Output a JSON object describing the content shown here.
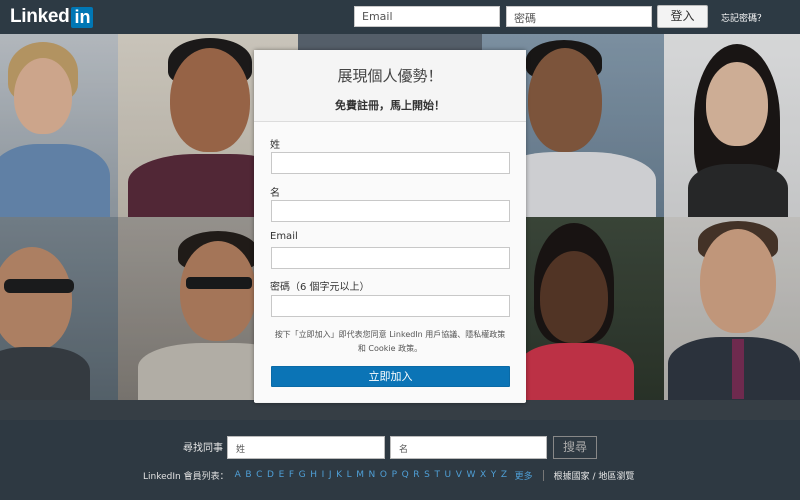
{
  "brand": {
    "logo_text": "Linked",
    "logo_box": "in"
  },
  "header": {
    "email_placeholder": "Email",
    "password_placeholder": "密碼",
    "login_label": "登入",
    "forgot_label": "忘記密碼？"
  },
  "signup": {
    "title": "展現個人優勢！",
    "subtitle": "免費註冊，馬上開始！",
    "last_name_label": "姓",
    "first_name_label": "名",
    "email_label": "Email",
    "password_label": "密碼（6 個字元以上）",
    "terms_line1": "按下「立即加入」即代表您同意 LinkedIn 用戶協議、隱私權政策",
    "terms_line2": "和 Cookie 政策。",
    "join_label": "立即加入"
  },
  "footer": {
    "find_label": "尋找同事",
    "last_name_placeholder": "姓",
    "first_name_placeholder": "名",
    "search_label": "搜尋",
    "directory_label": "LinkedIn 會員列表：",
    "letters": [
      "A",
      "B",
      "C",
      "D",
      "E",
      "F",
      "G",
      "H",
      "I",
      "J",
      "K",
      "L",
      "M",
      "N",
      "O",
      "P",
      "Q",
      "R",
      "S",
      "T",
      "U",
      "V",
      "W",
      "X",
      "Y",
      "Z"
    ],
    "more_label": "更多",
    "country_label": "根據國家 / 地區瀏覽"
  },
  "colors": {
    "brand_blue": "#0077b5",
    "topbar": "#2d3a44",
    "footer": "#2e3942",
    "link_blue": "#4f9fd6",
    "join_button": "#0b74b6"
  }
}
